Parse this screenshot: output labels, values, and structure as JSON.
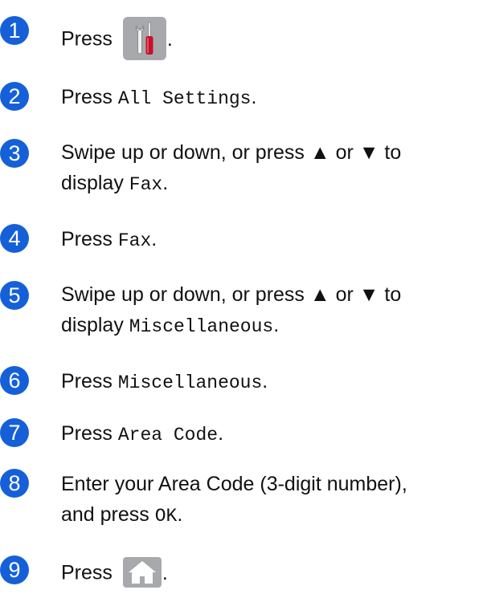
{
  "steps": [
    {
      "number": "1",
      "word": "Press",
      "icon": "settings-tools-icon",
      "tail": "."
    },
    {
      "number": "2",
      "word": "Press",
      "ui": "All Settings",
      "tail": "."
    },
    {
      "number": "3",
      "line1": "Swipe up or down, or press ▲ or ▼ to",
      "word": "display",
      "ui": "Fax",
      "tail": "."
    },
    {
      "number": "4",
      "word": "Press",
      "ui": "Fax",
      "tail": "."
    },
    {
      "number": "5",
      "line1": "Swipe up or down, or press ▲ or ▼ to",
      "word": "display",
      "ui": "Miscellaneous",
      "tail": "."
    },
    {
      "number": "6",
      "word": "Press",
      "ui": "Miscellaneous",
      "tail": "."
    },
    {
      "number": "7",
      "word": "Press",
      "ui": "Area Code",
      "tail": "."
    },
    {
      "number": "8",
      "line1": "Enter your Area Code (3-digit number),",
      "word": "and press",
      "ui": "OK",
      "tail": "."
    },
    {
      "number": "9",
      "word": "Press",
      "icon": "home-icon",
      "tail": "."
    }
  ],
  "colors": {
    "step_badge": "#1560d8",
    "icon_background": "#a7a9ac",
    "screwdriver_handle": "#c8102e"
  }
}
